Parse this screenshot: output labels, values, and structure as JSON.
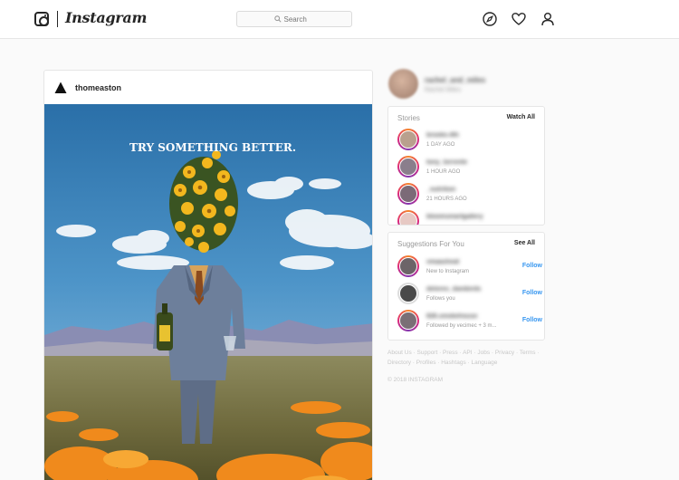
{
  "header": {
    "wordmark": "Instagram",
    "search_placeholder": "Search"
  },
  "post": {
    "username": "thomeaston",
    "image_headline": "TRY SOMETHING BETTER."
  },
  "me": {
    "username": "rachel_and_miles",
    "subtitle": "Rachel Miles"
  },
  "stories": {
    "title": "Stories",
    "action": "Watch All",
    "items": [
      {
        "name": "brooke.4th",
        "time": "1 DAY AGO"
      },
      {
        "name": "tony_torrente",
        "time": "1 HOUR AGO"
      },
      {
        "name": "_nutrition",
        "time": "21 HOURS AGO"
      },
      {
        "name": "bloomsmartgallery",
        "time": ""
      }
    ]
  },
  "suggestions": {
    "title": "Suggestions For You",
    "action": "See All",
    "items": [
      {
        "name": "vmaasheat",
        "sub": "New to Instagram",
        "follow": "Follow"
      },
      {
        "name": "delores_danibirds",
        "sub": "Follows you",
        "follow": "Follow"
      },
      {
        "name": "626.smokehouse",
        "sub": "Followed by vecimec + 3 m...",
        "follow": "Follow"
      }
    ]
  },
  "footer": {
    "links": "About Us · Support · Press · API · Jobs · Privacy · Terms · Directory · Profiles · Hashtags · Language",
    "copyright": "© 2018 INSTAGRAM"
  },
  "colors": {
    "link_blue": "#3897f0",
    "border": "#e6e6e6",
    "background": "#fafafa"
  }
}
